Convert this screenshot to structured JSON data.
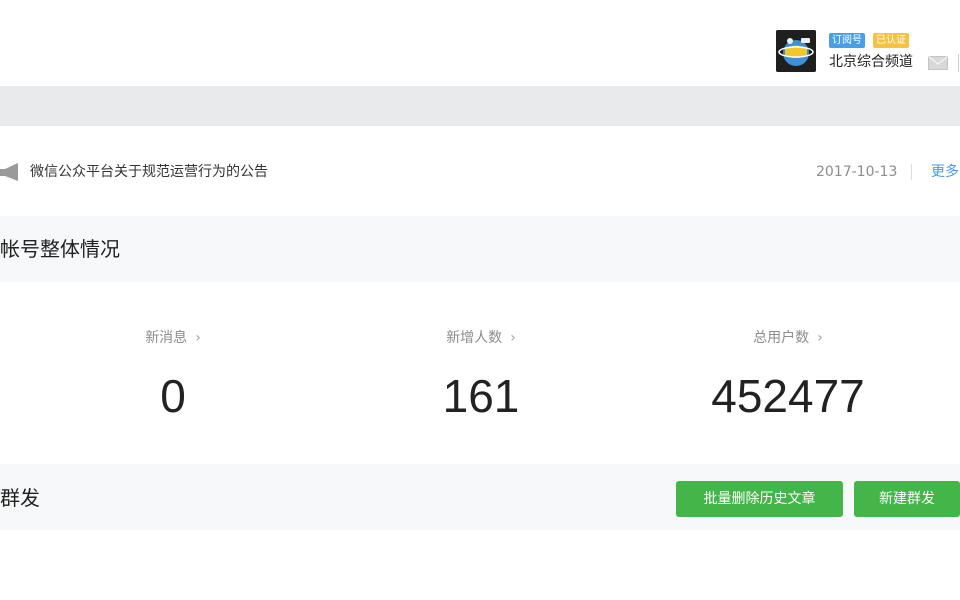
{
  "header": {
    "account_type_badge": "订阅号",
    "verified_badge": "已认证",
    "account_name": "北京综合频道",
    "avatar_icon": "globe-avatar-icon",
    "mail_icon": "mail-icon"
  },
  "notice": {
    "icon": "megaphone-icon",
    "title": "微信公众平台关于规范运营行为的公告",
    "date": "2017-10-13",
    "more_label": "更多"
  },
  "overview": {
    "title": "帐号整体情况",
    "stats": [
      {
        "label": "新消息",
        "value": "0"
      },
      {
        "label": "新增人数",
        "value": "161"
      },
      {
        "label": "总用户数",
        "value": "452477"
      }
    ]
  },
  "mass_send": {
    "title": "群发",
    "delete_history_label": "批量删除历史文章",
    "new_mass_label": "新建群发"
  },
  "colors": {
    "primary_button": "#44b549",
    "link": "#459ae9",
    "band": "#e9eaeb",
    "section_bg": "#f6f8f9",
    "badge_type": "#4aa0e6",
    "badge_verified": "#f5c242"
  }
}
